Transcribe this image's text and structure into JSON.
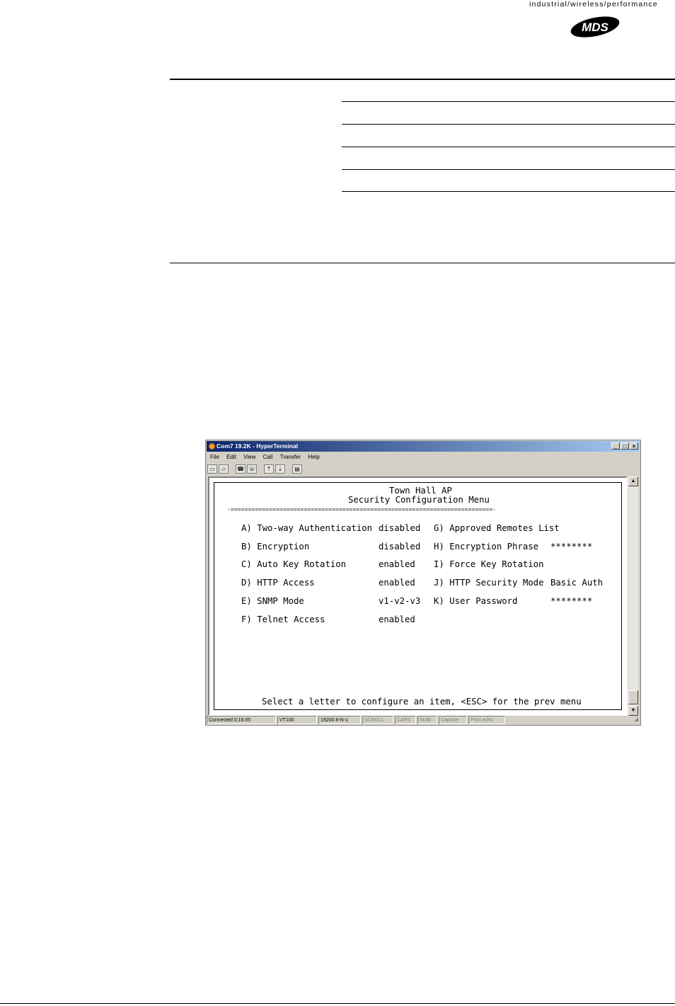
{
  "header": {
    "tagline": "industrial/wireless/performance",
    "logo_text": "MDS"
  },
  "window": {
    "title": "Com7 19.2K - HyperTerminal",
    "controls": [
      "_",
      "□",
      "×"
    ],
    "menu": [
      "File",
      "Edit",
      "View",
      "Call",
      "Transfer",
      "Help"
    ],
    "toolbar_icons": [
      "new-icon",
      "open-icon",
      "connect-icon",
      "disconnect-icon",
      "send-icon",
      "receive-icon",
      "properties-icon"
    ]
  },
  "terminal": {
    "title_line1": "Town Hall AP",
    "title_line2": "Security Configuration Menu",
    "separator": "-===========================================================================-",
    "left_items": [
      {
        "label": "A) Two-way Authentication",
        "value": "disabled"
      },
      {
        "label": "B) Encryption",
        "value": "disabled"
      },
      {
        "label": "C) Auto Key Rotation",
        "value": "enabled"
      },
      {
        "label": "D) HTTP Access",
        "value": "enabled"
      },
      {
        "label": "E) SNMP Mode",
        "value": "v1-v2-v3"
      },
      {
        "label": "F) Telnet Access",
        "value": "enabled"
      }
    ],
    "right_items": [
      {
        "label": "G) Approved Remotes List",
        "value": ""
      },
      {
        "label": "H) Encryption Phrase",
        "value": "********"
      },
      {
        "label": "I) Force Key Rotation",
        "value": ""
      },
      {
        "label": "J) HTTP Security Mode",
        "value": "Basic Auth"
      },
      {
        "label": "K) User Password",
        "value": "********"
      }
    ],
    "footer": "Select a letter to configure an item, <ESC> for the prev menu"
  },
  "statusbar": {
    "connected": "Connected 0:16:05",
    "emulation": "VT100",
    "settings": "19200 8-N-1",
    "scroll": "SCROLL",
    "caps": "CAPS",
    "num": "NUM",
    "capture": "Capture",
    "print_echo": "Print echo"
  }
}
